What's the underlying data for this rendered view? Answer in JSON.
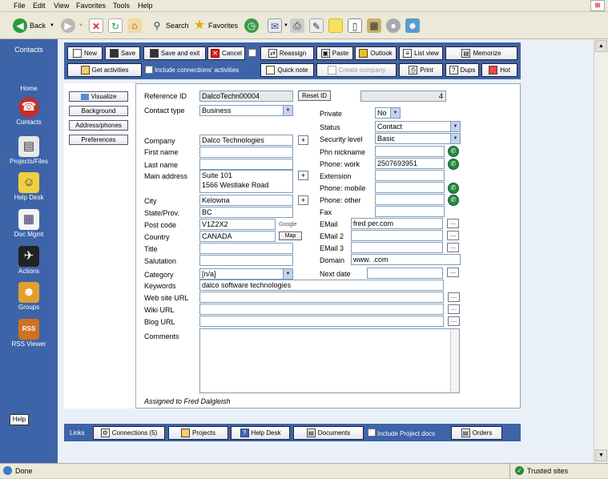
{
  "menu": [
    "File",
    "Edit",
    "View",
    "Favorites",
    "Tools",
    "Help"
  ],
  "toolbar": {
    "back": "Back",
    "search": "Search",
    "favorites": "Favorites"
  },
  "sidebar": {
    "title": "Contacts",
    "items": [
      {
        "label": "Home",
        "icon": "home-icon"
      },
      {
        "label": "Contacts",
        "icon": "contacts-icon"
      },
      {
        "label": "Projects/Files",
        "icon": "projects-icon"
      },
      {
        "label": "Help Desk",
        "icon": "helpdesk-icon"
      },
      {
        "label": "Doc Mgmt",
        "icon": "document-icon"
      },
      {
        "label": "Actions",
        "icon": "actions-icon"
      },
      {
        "label": "Groups",
        "icon": "groups-icon"
      },
      {
        "label": "RSS Viewer",
        "icon": "rss-icon"
      }
    ],
    "help": "Help"
  },
  "buttons": {
    "new": "New",
    "save": "Save",
    "save_exit": "Save and exit",
    "cancel": "Cancel",
    "reassign": "Reassign",
    "paste": "Paste",
    "outlook": "Outlook",
    "list_view": "List view",
    "memorize": "Memorize",
    "get_activities": "Get activities",
    "include_connections": "Include connections' activities",
    "quick_note": "Quick note",
    "create_company": "Create company",
    "print": "Print",
    "dups": "Dups",
    "hot": "Hot"
  },
  "side_buttons": [
    "Visualize",
    "Background",
    "Address/phones",
    "Preferences"
  ],
  "form": {
    "reference_id_label": "Reference ID",
    "reference_id": "DalcoTechn00004",
    "reset_id": "Reset ID",
    "count": "4",
    "contact_type_label": "Contact type",
    "contact_type": "Business",
    "private_label": "Private",
    "private": "No",
    "status_label": "Status",
    "status": "Contact",
    "security_label": "Security level",
    "security": "Basic",
    "company_label": "Company",
    "company": "Dalco Technologies",
    "first_name_label": "First name",
    "first_name": "",
    "last_name_label": "Last name",
    "last_name": "",
    "main_address_label": "Main address",
    "address1": "Suite 101",
    "address2": "1566 Westlake Road",
    "city_label": "City",
    "city": "Kelowna",
    "state_label": "State/Prov.",
    "state": "BC",
    "post_code_label": "Post code",
    "post_code": "V1Z2X2",
    "google": "Google",
    "country_label": "Country",
    "country": "CANADA",
    "map": "Map",
    "title_label": "Title",
    "title": "",
    "salutation_label": "Salutation",
    "salutation": "",
    "category_label": "Category",
    "category": "[n/a]",
    "keywords_label": "Keywords",
    "keywords": "dalco software technologies",
    "website_label": "Web site URL",
    "website": "",
    "wiki_label": "Wiki URL",
    "wiki": "",
    "blog_label": "Blog URL",
    "blog": "",
    "comments_label": "Comments",
    "comments": "",
    "phn_nickname_label": "Phn nickname",
    "phn_nickname": "",
    "phone_work_label": "Phone: work",
    "phone_work": "2507693951",
    "extension_label": "Extension",
    "extension": "",
    "phone_mobile_label": "Phone: mobile",
    "phone_mobile": "",
    "phone_other_label": "Phone: other",
    "phone_other": "",
    "fax_label": "Fax",
    "fax": "",
    "email_label": "EMail",
    "email": "fred          per.com",
    "email2_label": "EMail 2",
    "email2": "",
    "email3_label": "EMail 3",
    "email3": "",
    "domain_label": "Domain",
    "domain": "www.          .com",
    "next_date_label": "Next date",
    "next_date": "",
    "assigned": "Assigned to Fred Dalgleish"
  },
  "links": {
    "label": "Links",
    "connections": "Connections (5)",
    "projects": "Projects",
    "help_desk": "Help Desk",
    "documents": "Documents",
    "include_project_docs": "Include Project docs",
    "orders": "Orders"
  },
  "status": {
    "left": "Done",
    "right": "Trusted sites"
  }
}
